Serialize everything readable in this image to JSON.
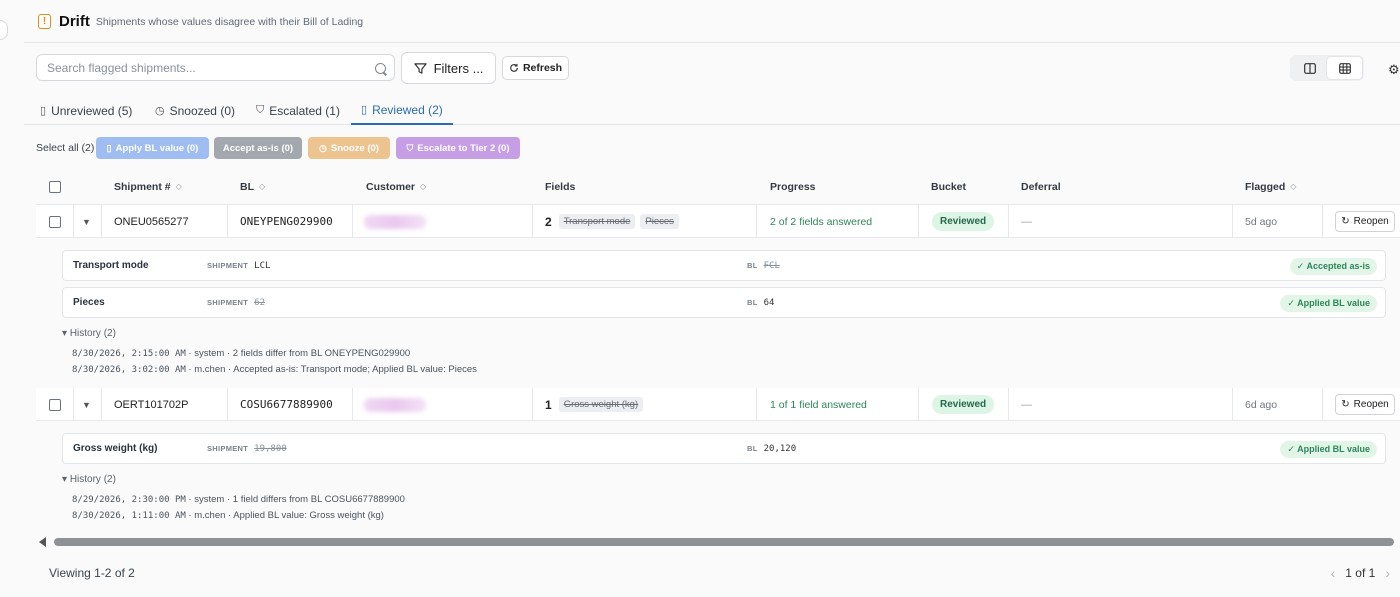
{
  "header": {
    "title": "Drift",
    "subtitle": "Shipments whose values disagree with their Bill of Lading"
  },
  "toolbar": {
    "search_placeholder": "Search flagged shipments...",
    "filters_label": "Filters ...",
    "refresh_label": "Refresh"
  },
  "tabs": [
    {
      "label": "Unreviewed (5)",
      "icon": "alert-file-icon",
      "active": false
    },
    {
      "label": "Snoozed (0)",
      "icon": "clock-icon",
      "active": false
    },
    {
      "label": "Escalated (1)",
      "icon": "shield-icon",
      "active": false
    },
    {
      "label": "Reviewed (2)",
      "icon": "check-file-icon",
      "active": true
    }
  ],
  "bulk": {
    "select_all": "Select all (2)",
    "apply_bl": "Apply BL value (0)",
    "accept": "Accept as-is (0)",
    "snooze": "Snooze (0)",
    "escalate": "Escalate to Tier 2 (0)",
    "colors": {
      "apply_bl": "#9fbdf0",
      "accept": "#a3a8ae",
      "snooze": "#edc38f",
      "escalate": "#c59ee6"
    }
  },
  "columns": {
    "shipment": "Shipment #",
    "bl": "BL",
    "customer": "Customer",
    "fields": "Fields",
    "progress": "Progress",
    "bucket": "Bucket",
    "deferral": "Deferral",
    "flagged": "Flagged"
  },
  "rows": [
    {
      "shipment": "ONEU0565277",
      "bl": "ONEYPENG029900",
      "field_count": "2",
      "field_chips": [
        "Transport mode",
        "Pieces"
      ],
      "progress": "2 of 2 fields answered",
      "bucket": "Reviewed",
      "deferral": "—",
      "flagged": "5d ago",
      "action": "Reopen",
      "fields": [
        {
          "label": "Transport mode",
          "shipment_key": "SHIPMENT",
          "shipment_value": "LCL",
          "bl_key": "BL",
          "bl_value": "FCL",
          "resolution": "Accepted as-is"
        },
        {
          "label": "Pieces",
          "shipment_key": "SHIPMENT",
          "shipment_value": "62",
          "bl_key": "BL",
          "bl_value": "64",
          "resolution": "Applied BL value"
        }
      ],
      "history_label": "History (2)",
      "history": [
        {
          "ts": "8/30/2026, 2:15:00 AM",
          "text": " · system · 2 fields differ from BL ONEYPENG029900"
        },
        {
          "ts": "8/30/2026, 3:02:00 AM",
          "text": " · m.chen · Accepted as-is: Transport mode; Applied BL value: Pieces"
        }
      ]
    },
    {
      "shipment": "OERT101702P",
      "bl": "COSU6677889900",
      "field_count": "1",
      "field_chips": [
        "Gross weight (kg)"
      ],
      "progress": "1 of 1 field answered",
      "bucket": "Reviewed",
      "deferral": "—",
      "flagged": "6d ago",
      "action": "Reopen",
      "fields": [
        {
          "label": "Gross weight (kg)",
          "shipment_key": "SHIPMENT",
          "shipment_value": "19,800",
          "bl_key": "BL",
          "bl_value": "20,120",
          "resolution": "Applied BL value"
        }
      ],
      "history_label": "History (2)",
      "history": [
        {
          "ts": "8/29/2026, 2:30:00 PM",
          "text": " · system · 1 field differs from BL COSU6677889900"
        },
        {
          "ts": "8/30/2026, 1:11:00 AM",
          "text": " · m.chen · Applied BL value: Gross weight (kg)"
        }
      ]
    }
  ],
  "footer": {
    "viewing": "Viewing 1-2 of 2",
    "page": "1 of 1"
  }
}
